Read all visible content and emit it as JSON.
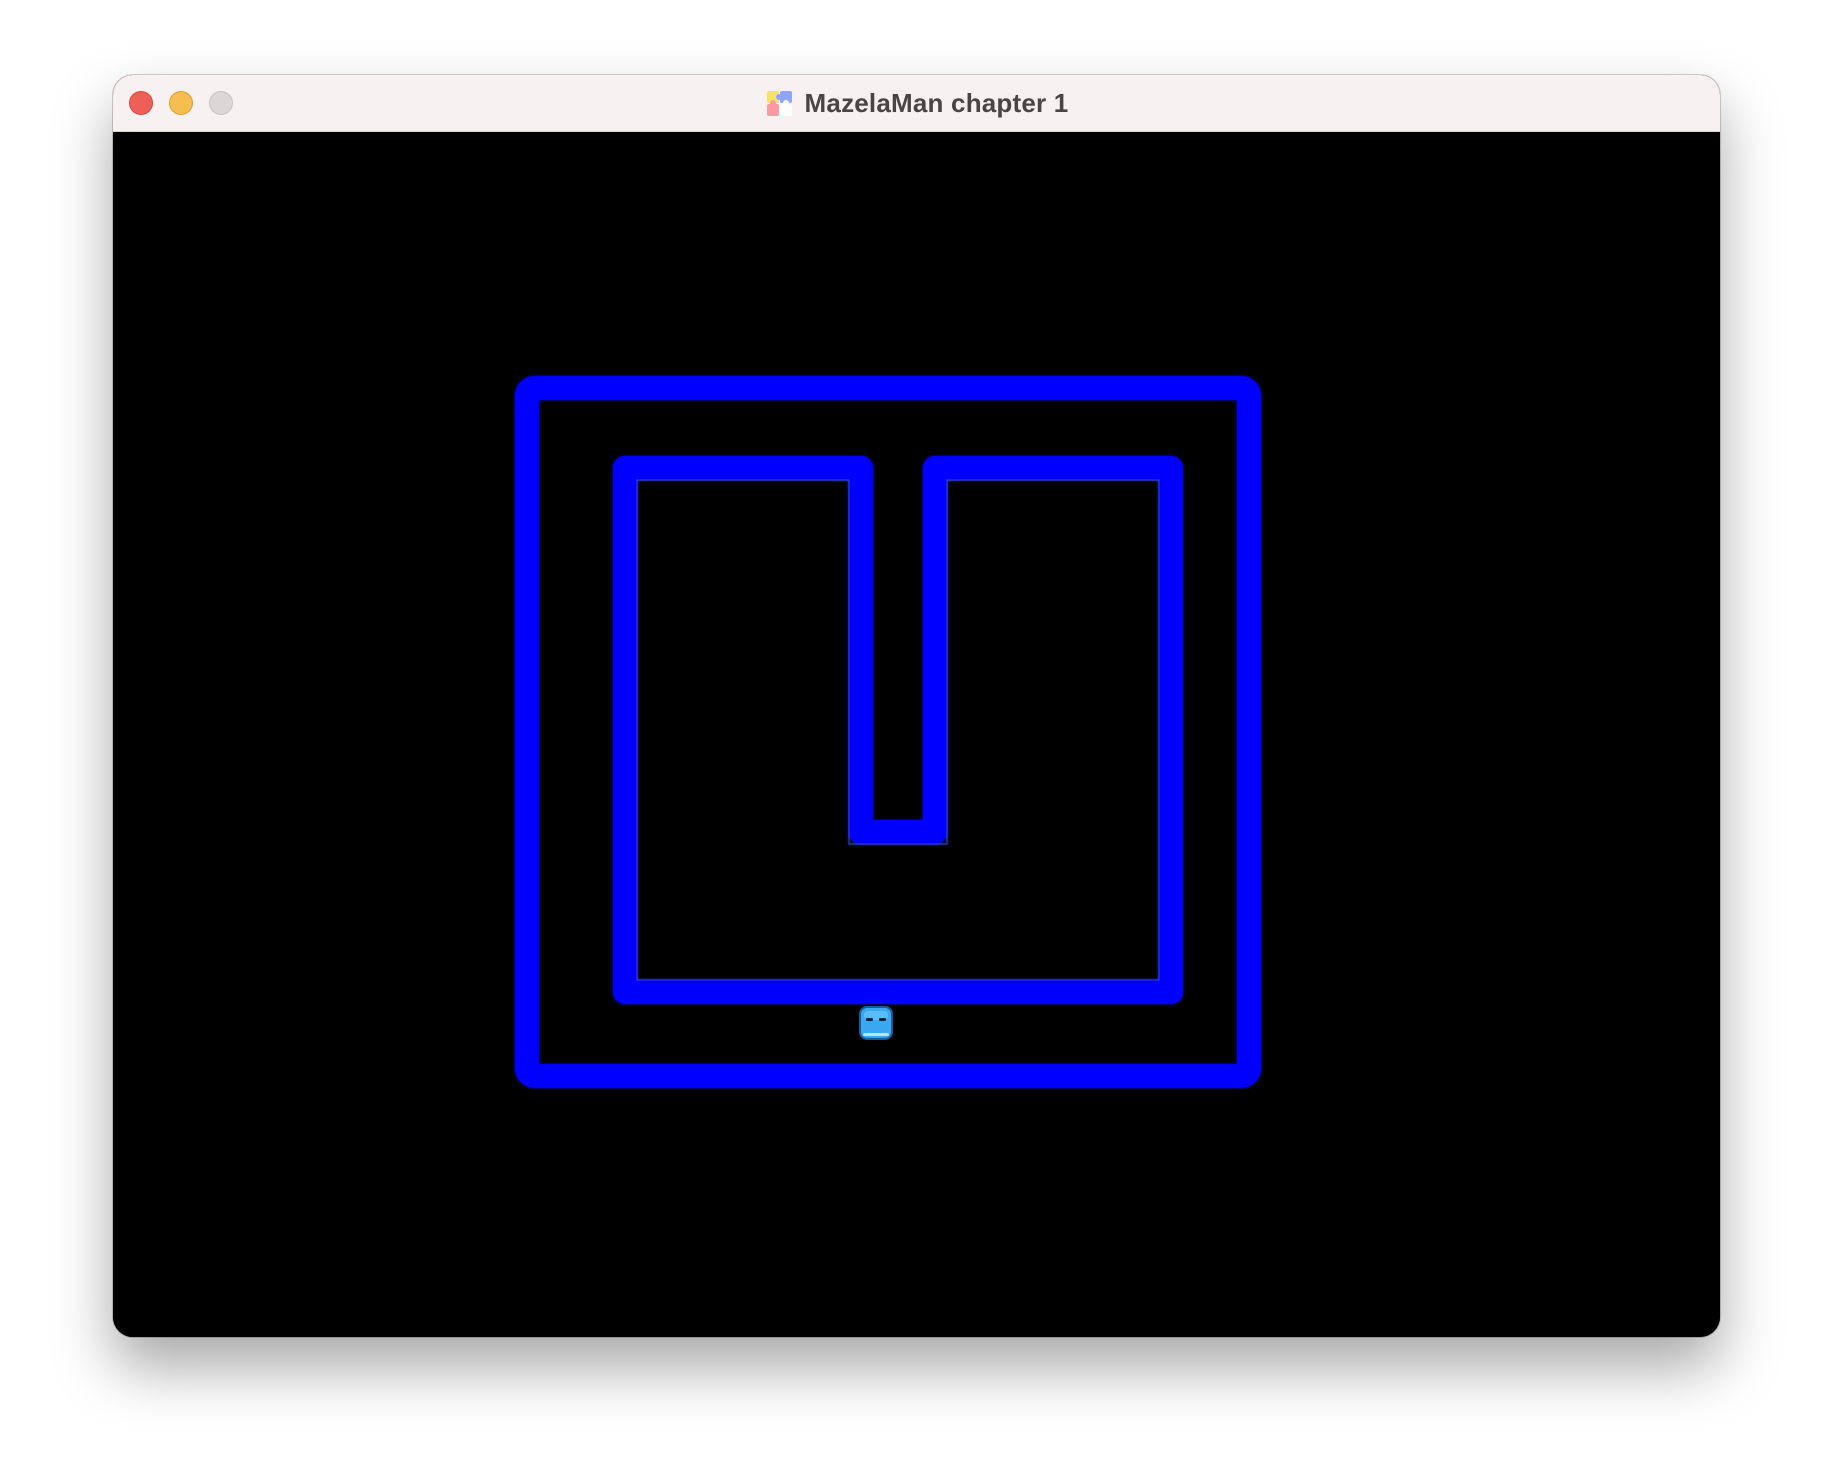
{
  "window": {
    "title": "MazelaMan chapter 1",
    "app_icon": "puzzle-piece-icon"
  },
  "controls": {
    "close": "close-window-icon",
    "minimize": "minimize-window-icon",
    "zoom": "zoom-window-icon"
  },
  "game": {
    "background_color": "#000000",
    "wall_color": "#0000ff",
    "player_color": "#3aa8f0",
    "player": "mazelaman-player-icon"
  }
}
